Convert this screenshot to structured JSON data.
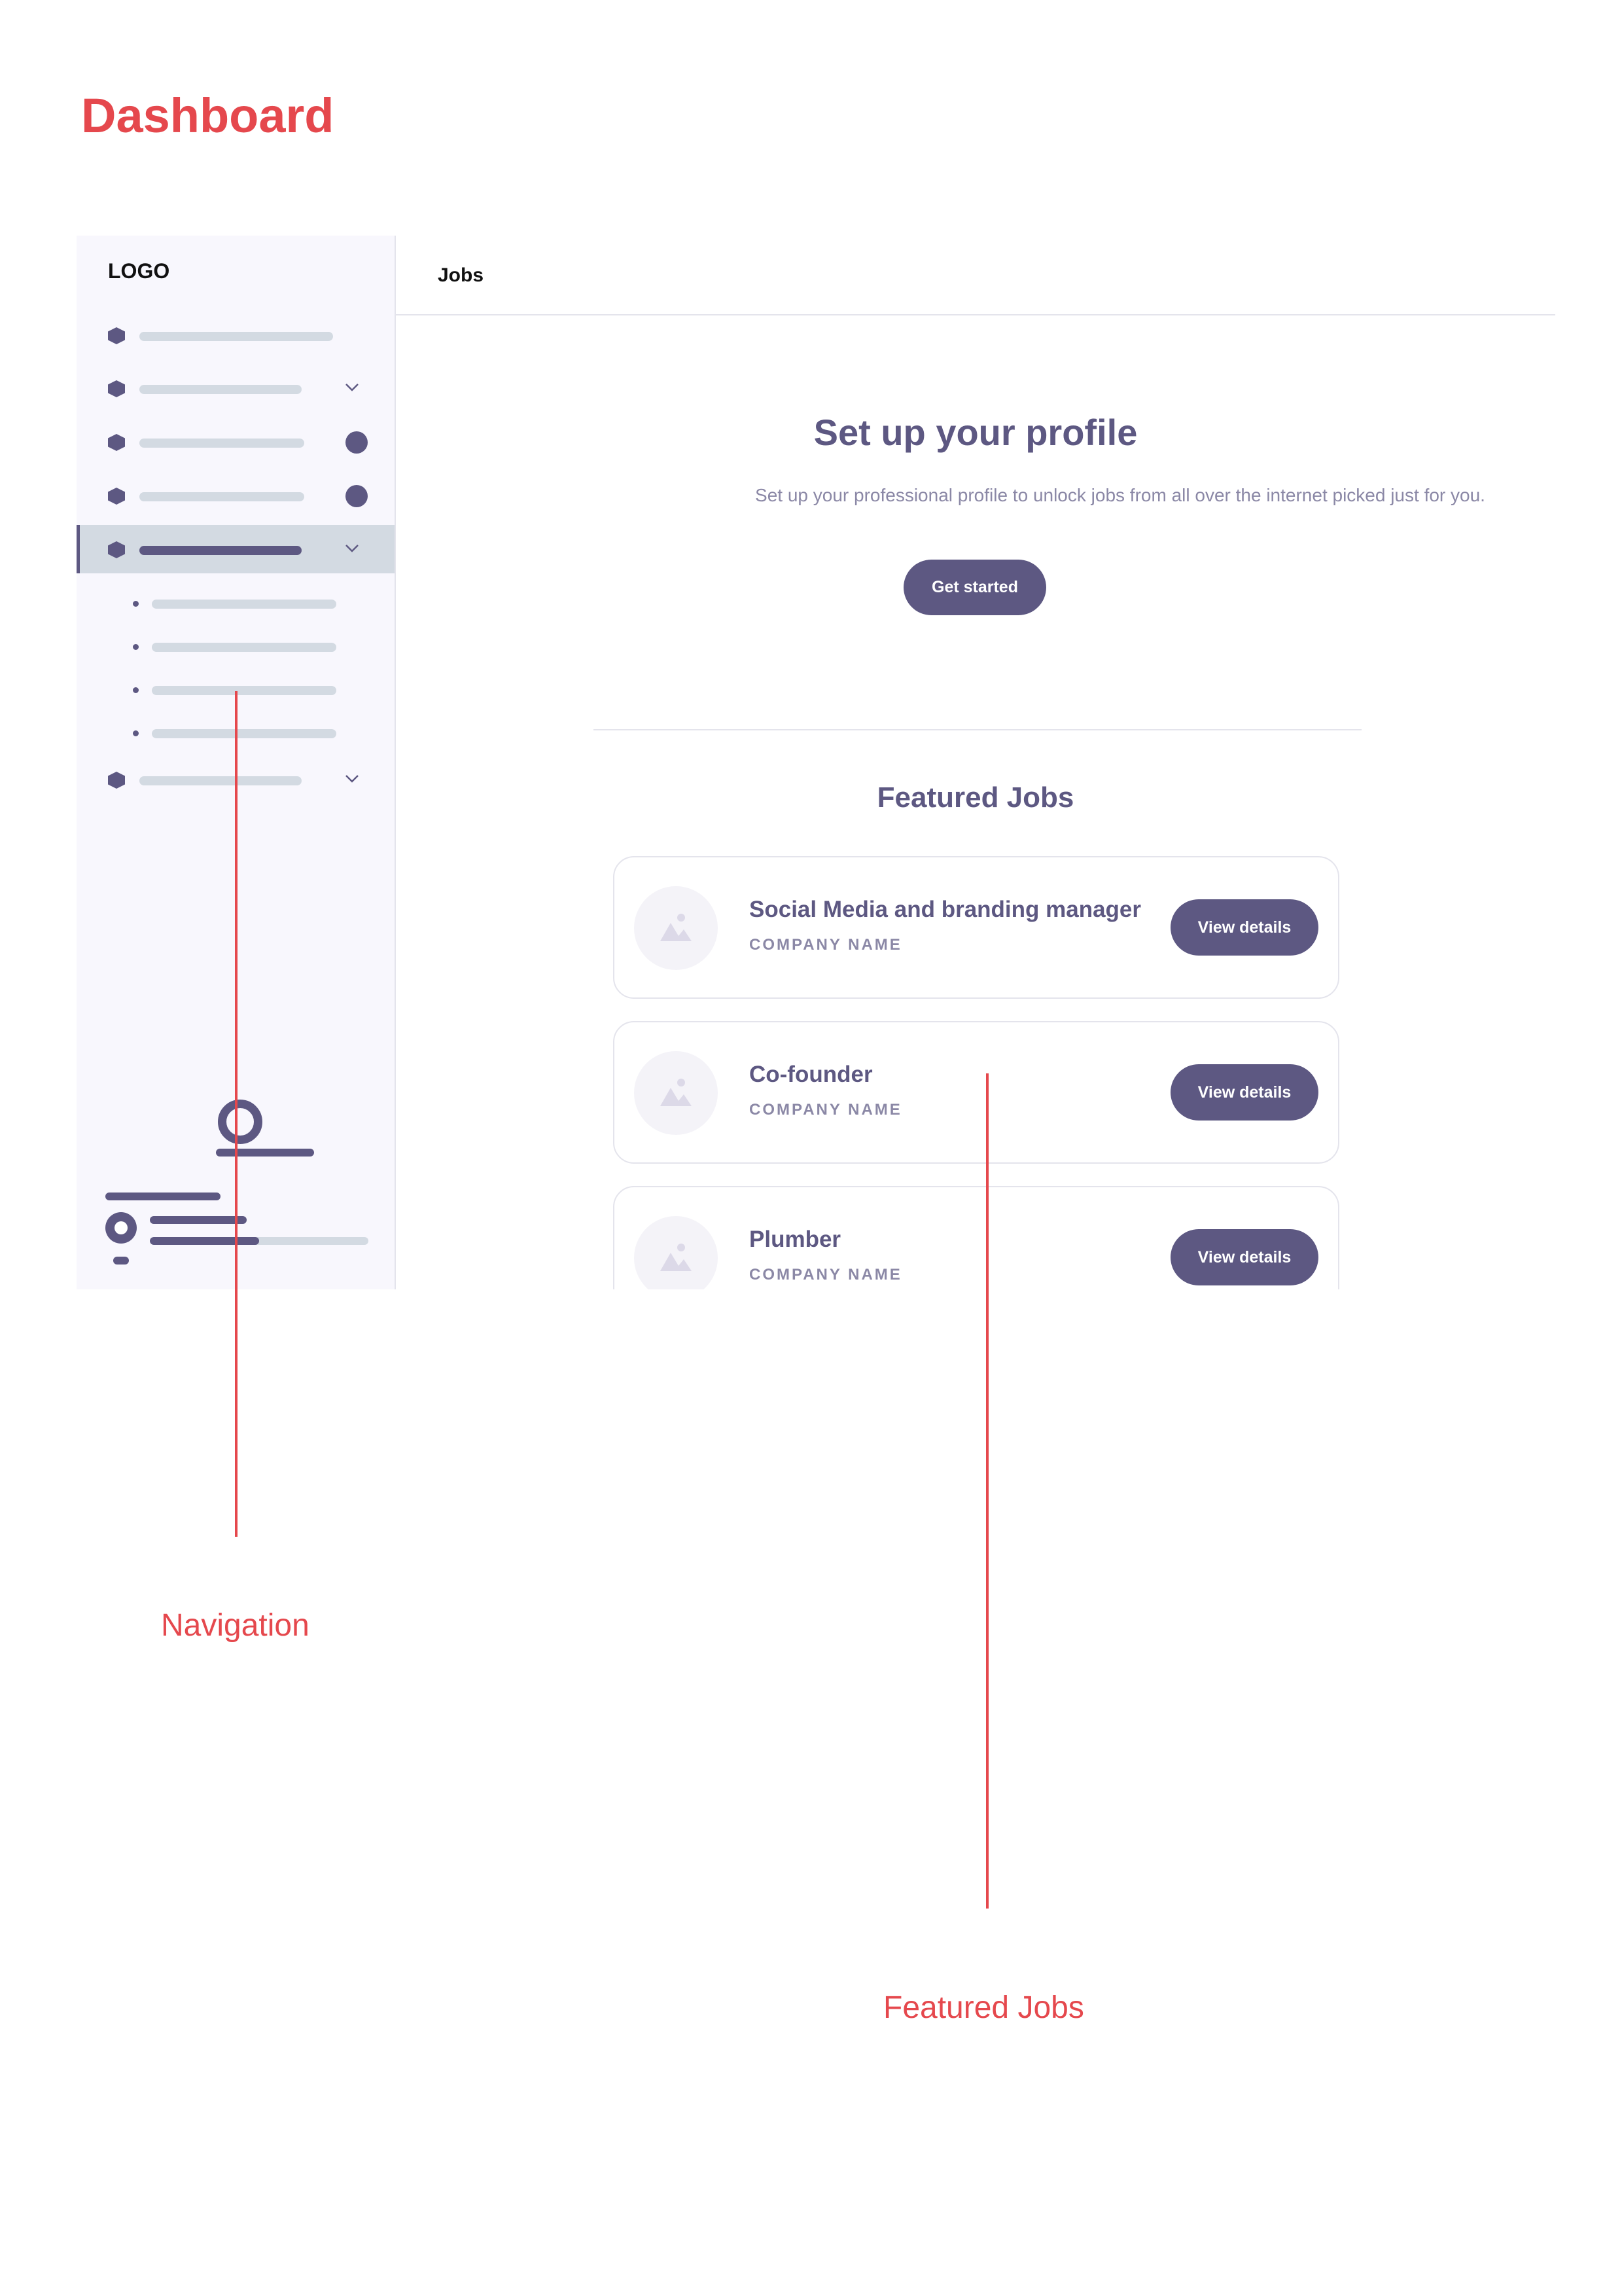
{
  "page_title": "Dashboard",
  "sidebar": {
    "logo": "LOGO",
    "user": {
      "progress_fraction": 0.5
    }
  },
  "header": {
    "tab_label": "Jobs"
  },
  "profile": {
    "title": "Set up your profile",
    "description": "Set up your professional profile to unlock jobs from all over the internet picked just for you.",
    "cta_label": "Get started"
  },
  "featured": {
    "title": "Featured Jobs",
    "jobs": [
      {
        "title": "Social Media and branding manager",
        "company": "COMPANY NAME",
        "button": "View details"
      },
      {
        "title": "Co-founder",
        "company": "COMPANY NAME",
        "button": "View details"
      },
      {
        "title": "Plumber",
        "company": "COMPANY NAME",
        "button": "View details"
      }
    ]
  },
  "annotations": {
    "navigation": "Navigation",
    "featured_jobs": "Featured Jobs"
  },
  "colors": {
    "accent": "#5d5882",
    "annotation": "#e5484d",
    "placeholder": "#d3dae2",
    "sidebar_bg": "#f8f7fd"
  },
  "icons": {
    "nav": "hexagon-icon",
    "expand": "chevron-down-icon",
    "job_thumb": "image-placeholder-icon"
  }
}
